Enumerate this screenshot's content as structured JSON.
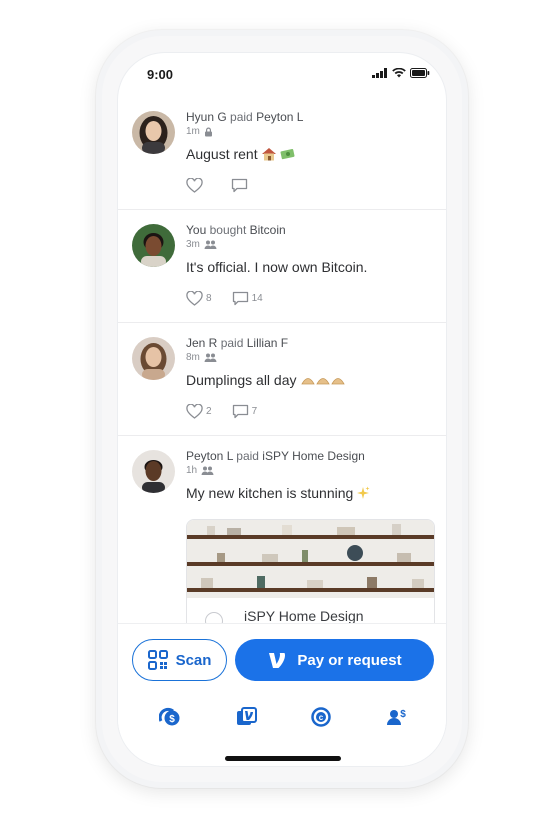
{
  "status_bar": {
    "time": "9:00"
  },
  "feed": [
    {
      "actor": "Hyun G",
      "verb": "paid",
      "target": "Peyton L",
      "time": "1m",
      "privacy": "lock-icon",
      "note": "August rent",
      "likes": "",
      "comments": ""
    },
    {
      "actor": "You",
      "verb": "bought",
      "target": "Bitcoin",
      "time": "3m",
      "privacy": "friends-icon",
      "note": "It's official. I now own Bitcoin.",
      "likes": "8",
      "comments": "14"
    },
    {
      "actor": "Jen R",
      "verb": "paid",
      "target": "Lillian F",
      "time": "8m",
      "privacy": "friends-icon",
      "note": "Dumplings all day",
      "likes": "2",
      "comments": "7"
    },
    {
      "actor": "Peyton L",
      "verb": "paid",
      "target": "iSPY Home Design",
      "time": "1h",
      "privacy": "friends-icon",
      "note": "My new kitchen is stunning",
      "media": {
        "title": "iSPY Home Design"
      }
    }
  ],
  "bottom_bar": {
    "scan_label": "Scan",
    "pay_label": "Pay or request",
    "nav": [
      "home-dollar-icon",
      "venmo-icon",
      "crypto-icon",
      "contacts-dollar-icon"
    ]
  },
  "colors": {
    "accent": "#1b72e8",
    "accent_dark": "#1a66cc",
    "text": "#2f3033",
    "muted": "#8a8d93"
  }
}
